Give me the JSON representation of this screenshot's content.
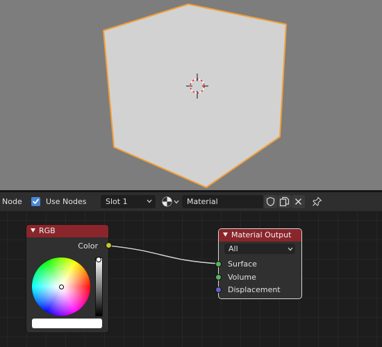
{
  "colors": {
    "viewport_bg": "#7d7d7d",
    "cube_face": "#d2d2d2",
    "selection_outline": "#f29f38",
    "node_header_red": "#8a262b",
    "socket_color": "#c7c729",
    "socket_shader": "#56b45b",
    "socket_vector": "#6363c7",
    "checkbox_blue": "#4a87d8"
  },
  "header": {
    "editor_label": "Node",
    "use_nodes_label": "Use Nodes",
    "use_nodes_checked": true,
    "slot_value": "Slot 1",
    "material_name": "Material",
    "icons": [
      "sphere-preview-icon",
      "chevron-down-icon",
      "fake-user-shield-icon",
      "duplicate-icon",
      "close-icon",
      "pin-icon"
    ]
  },
  "nodes": {
    "rgb": {
      "title": "RGB",
      "output_label": "Color",
      "brightness": 1.0,
      "hex_color": "#ffffff"
    },
    "material_output": {
      "title": "Material Output",
      "target": "All",
      "inputs": [
        "Surface",
        "Volume",
        "Displacement"
      ]
    }
  },
  "viewport": {
    "object": "Cube",
    "selected": true,
    "cursor_icon": "3d-cursor-icon"
  }
}
